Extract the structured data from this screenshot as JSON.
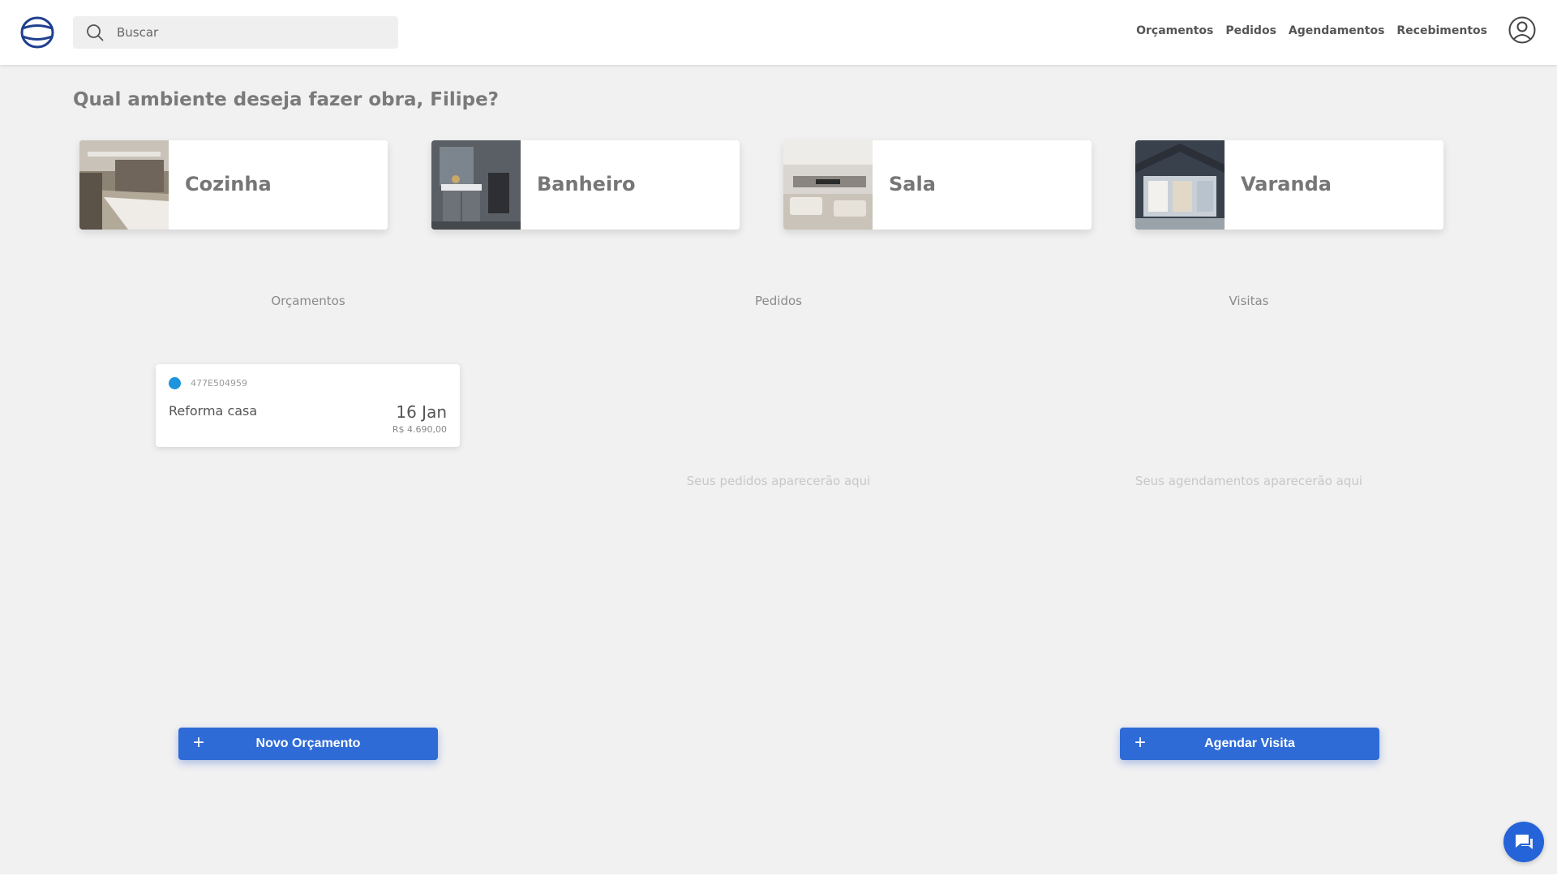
{
  "search": {
    "placeholder": "Buscar"
  },
  "nav": {
    "items": [
      "Orçamentos",
      "Pedidos",
      "Agendamentos",
      "Recebimentos"
    ]
  },
  "greeting": "Qual ambiente deseja fazer obra, Filipe?",
  "rooms": [
    {
      "label": "Cozinha"
    },
    {
      "label": "Banheiro"
    },
    {
      "label": "Sala"
    },
    {
      "label": "Varanda"
    }
  ],
  "columns": {
    "quotes": {
      "title": "Orçamentos",
      "items": [
        {
          "id": "477E504959",
          "name": "Reforma casa",
          "date": "16 Jan",
          "price": "R$ 4.690,00",
          "status_color": "#1e94dc"
        }
      ],
      "button_label": "Novo Orçamento"
    },
    "orders": {
      "title": "Pedidos",
      "empty": "Seus pedidos aparecerão aqui"
    },
    "visits": {
      "title": "Visitas",
      "empty": "Seus agendamentos aparecerão aqui",
      "button_label": "Agendar Visita"
    }
  },
  "icons": {
    "logo": "logo-icon",
    "search": "search-icon",
    "avatar": "user-circle-icon",
    "chat": "chat-icon",
    "plus": "plus-icon"
  },
  "colors": {
    "accent": "#2e6bd6",
    "status": "#1e94dc",
    "background": "#f1f1f1"
  }
}
